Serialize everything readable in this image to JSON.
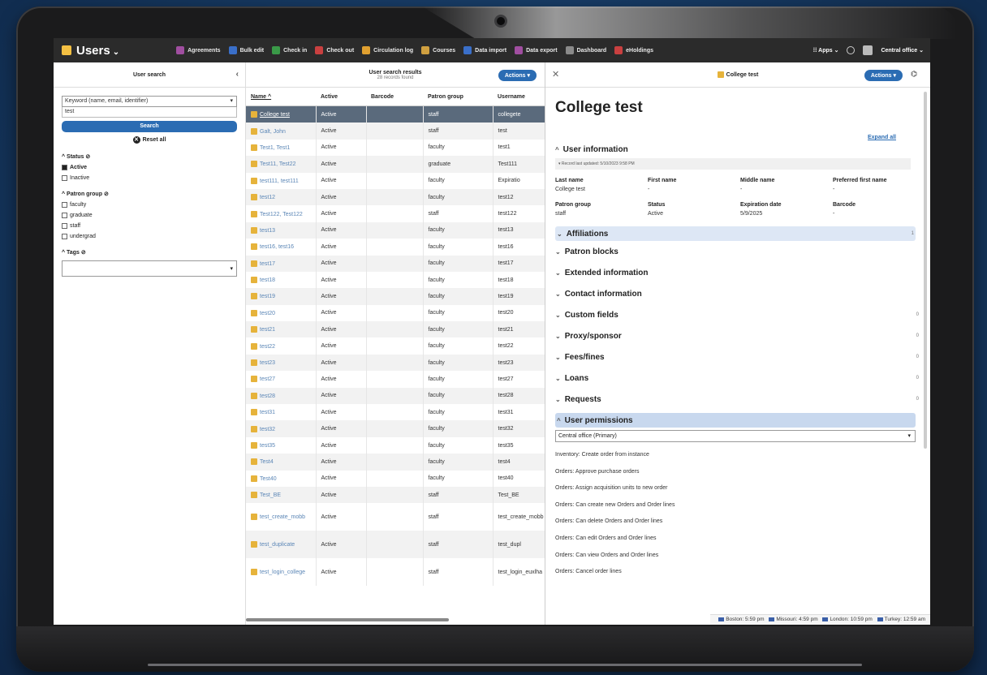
{
  "colors": {
    "accent": "#2b6cb3",
    "nav_bg": "#2b2b2b",
    "selected_row": "#5a6a7c"
  },
  "app": {
    "title": "Users",
    "icon": "users-app-icon"
  },
  "nav": {
    "links": [
      {
        "label": "Agreements",
        "icon": "agreements-icon",
        "color": "#a04ea0"
      },
      {
        "label": "Bulk edit",
        "icon": "bulk-edit-icon",
        "color": "#3a6fc9"
      },
      {
        "label": "Check in",
        "icon": "check-in-icon",
        "color": "#3a9a48"
      },
      {
        "label": "Check out",
        "icon": "check-out-icon",
        "color": "#c94040"
      },
      {
        "label": "Circulation log",
        "icon": "circulation-log-icon",
        "color": "#e0a030"
      },
      {
        "label": "Courses",
        "icon": "courses-icon",
        "color": "#d0a040"
      },
      {
        "label": "Data import",
        "icon": "data-import-icon",
        "color": "#3a6fc9"
      },
      {
        "label": "Data export",
        "icon": "data-export-icon",
        "color": "#a04ea0"
      },
      {
        "label": "Dashboard",
        "icon": "dashboard-icon",
        "color": "#8a8a8a"
      },
      {
        "label": "eHoldings",
        "icon": "eholdings-icon",
        "color": "#c94040"
      }
    ],
    "apps_label": "Apps",
    "location_label": "Central office"
  },
  "search_pane": {
    "title": "User search",
    "index_select": "Keyword (name, email, identifier)",
    "query": "test",
    "search_button": "Search",
    "reset_label": "Reset all",
    "status_heading": "Status",
    "status_options": [
      {
        "label": "Active",
        "checked": true
      },
      {
        "label": "Inactive",
        "checked": false
      }
    ],
    "patron_heading": "Patron group",
    "patron_options": [
      "faculty",
      "graduate",
      "staff",
      "undergrad"
    ],
    "tags_heading": "Tags"
  },
  "results": {
    "title": "User search results",
    "count_text": "28 records found",
    "actions_label": "Actions",
    "columns": [
      "Name",
      "Active",
      "Barcode",
      "Patron group",
      "Username"
    ],
    "rows": [
      [
        "College test",
        "Active",
        "",
        "staff",
        "collegete"
      ],
      [
        "Galt, John",
        "Active",
        "",
        "staff",
        "test"
      ],
      [
        "Test1, Test1",
        "Active",
        "",
        "faculty",
        "test1"
      ],
      [
        "Test11, Test22",
        "Active",
        "",
        "graduate",
        "Test111"
      ],
      [
        "test111, test111",
        "Active",
        "",
        "faculty",
        "Expiratio"
      ],
      [
        "test12",
        "Active",
        "",
        "faculty",
        "test12"
      ],
      [
        "Test122, Test122",
        "Active",
        "",
        "staff",
        "test122"
      ],
      [
        "test13",
        "Active",
        "",
        "faculty",
        "test13"
      ],
      [
        "test16, test16",
        "Active",
        "",
        "faculty",
        "test16"
      ],
      [
        "test17",
        "Active",
        "",
        "faculty",
        "test17"
      ],
      [
        "test18",
        "Active",
        "",
        "faculty",
        "test18"
      ],
      [
        "test19",
        "Active",
        "",
        "faculty",
        "test19"
      ],
      [
        "test20",
        "Active",
        "",
        "faculty",
        "test20"
      ],
      [
        "test21",
        "Active",
        "",
        "faculty",
        "test21"
      ],
      [
        "test22",
        "Active",
        "",
        "faculty",
        "test22"
      ],
      [
        "test23",
        "Active",
        "",
        "faculty",
        "test23"
      ],
      [
        "test27",
        "Active",
        "",
        "faculty",
        "test27"
      ],
      [
        "test28",
        "Active",
        "",
        "faculty",
        "test28"
      ],
      [
        "test31",
        "Active",
        "",
        "faculty",
        "test31"
      ],
      [
        "test32",
        "Active",
        "",
        "faculty",
        "test32"
      ],
      [
        "test35",
        "Active",
        "",
        "faculty",
        "test35"
      ],
      [
        "Test4",
        "Active",
        "",
        "faculty",
        "test4"
      ],
      [
        "Test40",
        "Active",
        "",
        "faculty",
        "test40"
      ],
      [
        "Test_BE",
        "Active",
        "",
        "staff",
        "Test_BE"
      ]
    ],
    "tall_rows": [
      [
        "test_create_mobb",
        "Active",
        "",
        "staff",
        "test_create_mobb"
      ],
      [
        "test_duplicate",
        "Active",
        "",
        "staff",
        "test_dupl"
      ],
      [
        "test_login_college",
        "Active",
        "",
        "staff",
        "test_login_euxlha"
      ]
    ]
  },
  "detail": {
    "header_title": "College test",
    "actions_label": "Actions",
    "name": "College test",
    "expand_all": "Expand all",
    "user_info_heading": "User information",
    "record_updated": "Record last updated: 5/10/2023 9:58 PM",
    "fields": [
      {
        "label": "Last name",
        "value": "College test"
      },
      {
        "label": "First name",
        "value": "-"
      },
      {
        "label": "Middle name",
        "value": "-"
      },
      {
        "label": "Preferred first name",
        "value": "-"
      },
      {
        "label": "Patron group",
        "value": "staff"
      },
      {
        "label": "Status",
        "value": "Active"
      },
      {
        "label": "Expiration date",
        "value": "5/9/2025"
      },
      {
        "label": "Barcode",
        "value": "-"
      }
    ],
    "sections": [
      {
        "label": "Affiliations",
        "count": "1"
      },
      {
        "label": "Patron blocks",
        "count": ""
      },
      {
        "label": "Extended information",
        "count": ""
      },
      {
        "label": "Contact information",
        "count": ""
      },
      {
        "label": "Custom fields",
        "count": "0"
      },
      {
        "label": "Proxy/sponsor",
        "count": "0"
      },
      {
        "label": "Fees/fines",
        "count": "0"
      },
      {
        "label": "Loans",
        "count": "0"
      },
      {
        "label": "Requests",
        "count": "0"
      }
    ],
    "permissions_heading": "User permissions",
    "permissions_affiliation": "Central office (Primary)",
    "permissions": [
      "Inventory: Create order from instance",
      "Orders: Approve purchase orders",
      "Orders: Assign acquisition units to new order",
      "Orders: Can create new Orders and Order lines",
      "Orders: Can delete Orders and Order lines",
      "Orders: Can edit Orders and Order lines",
      "Orders: Can view Orders and Order lines",
      "Orders: Cancel order lines"
    ]
  },
  "statusbar": {
    "clocks": [
      "Boston: 5:59 pm",
      "Missouri: 4:59 pm",
      "London: 10:59 pm",
      "Turkey: 12:59 am"
    ]
  }
}
